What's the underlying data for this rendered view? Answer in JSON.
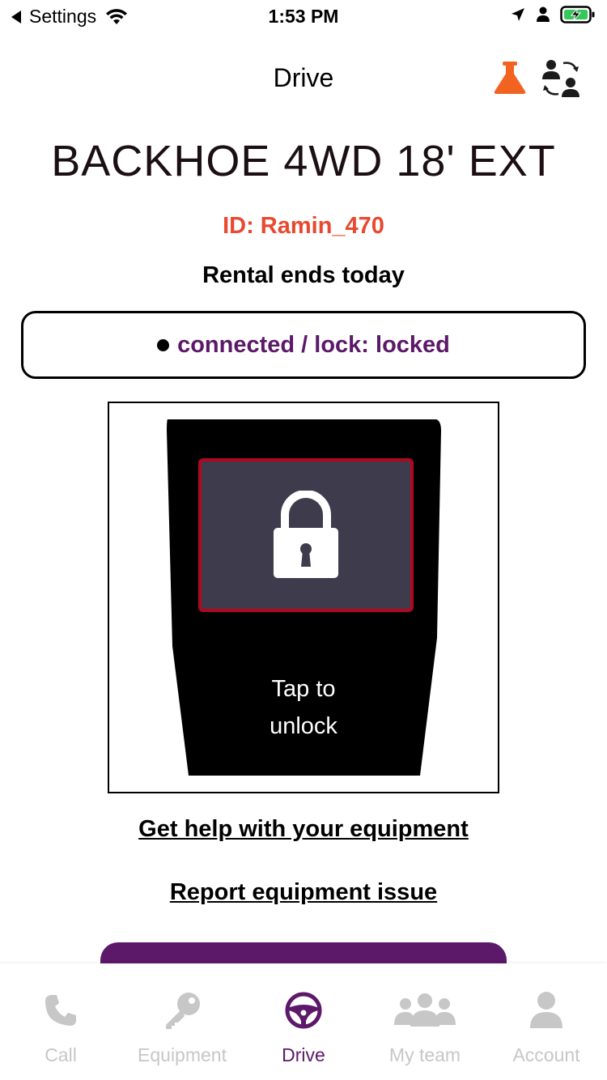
{
  "status_bar": {
    "back_app": "Settings",
    "time": "1:53 PM"
  },
  "header": {
    "title": "Drive",
    "flask_icon": "flask-icon",
    "switch_icon": "team-switch-icon"
  },
  "equipment": {
    "name": "BACKHOE 4WD 18' EXT",
    "id": "ID: Ramin_470",
    "rental_status": "Rental ends today",
    "connection": "connected / lock: locked"
  },
  "lock_panel": {
    "tap_line1": "Tap to",
    "tap_line2": "unlock"
  },
  "links": {
    "help": "Get help with your equipment",
    "report": "Report equipment issue"
  },
  "tabs": [
    {
      "label": "Call",
      "icon": "phone-icon"
    },
    {
      "label": "Equipment",
      "icon": "key-icon"
    },
    {
      "label": "Drive",
      "icon": "steering-wheel-icon"
    },
    {
      "label": "My team",
      "icon": "team-icon"
    },
    {
      "label": "Account",
      "icon": "account-icon"
    }
  ],
  "colors": {
    "accent": "#5c1869",
    "id_red": "#e8492f",
    "flask_orange": "#f26322",
    "lock_border": "#b0081f",
    "inactive_tab": "#c7c7c7"
  }
}
